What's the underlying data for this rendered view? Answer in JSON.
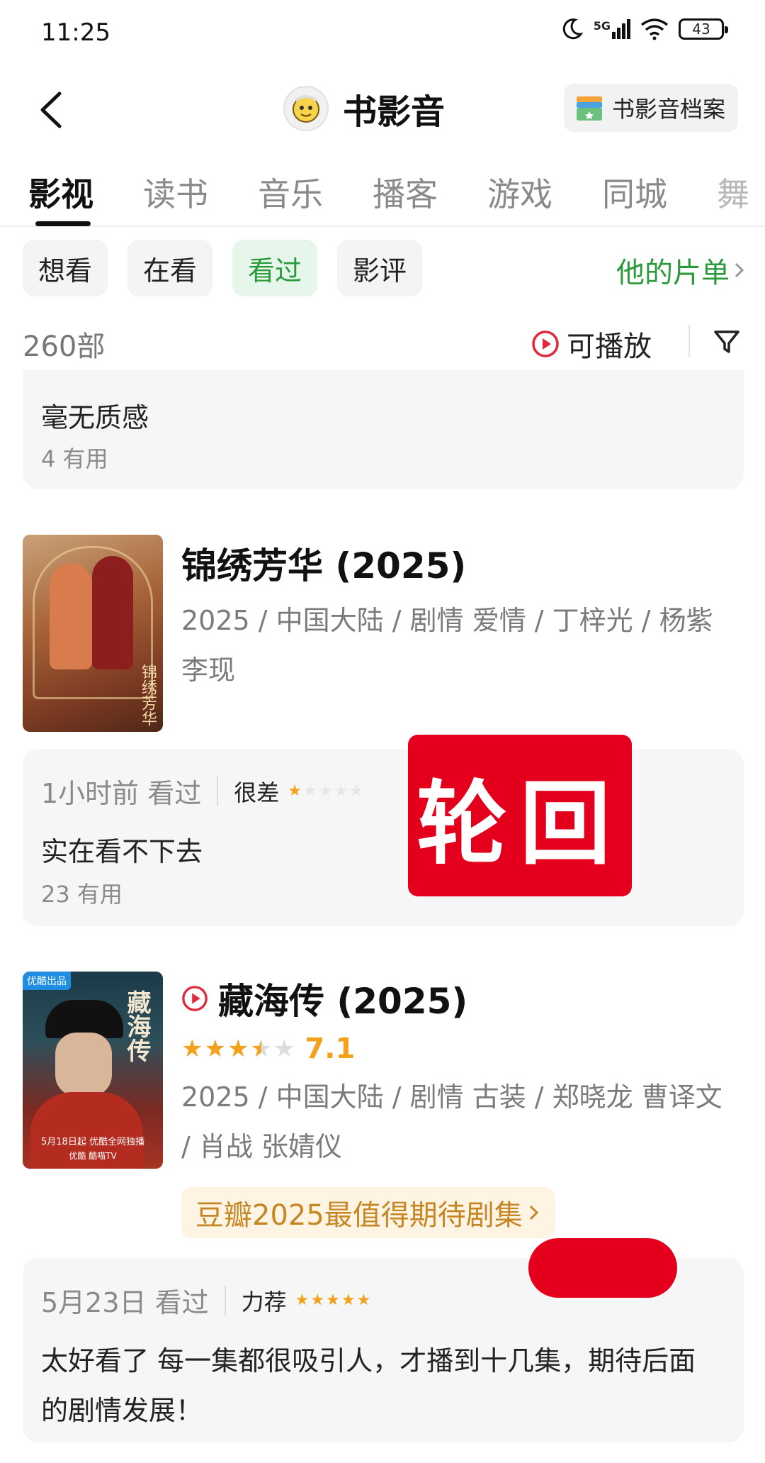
{
  "status_bar": {
    "time": "11:25",
    "network": "5G",
    "battery": "43"
  },
  "header": {
    "title": "书影音",
    "archive_label": "书影音档案"
  },
  "tabs": [
    {
      "label": "影视",
      "active": true
    },
    {
      "label": "读书",
      "active": false
    },
    {
      "label": "音乐",
      "active": false
    },
    {
      "label": "播客",
      "active": false
    },
    {
      "label": "游戏",
      "active": false
    },
    {
      "label": "同城",
      "active": false
    },
    {
      "label": "舞",
      "active": false
    }
  ],
  "filters": {
    "chips": [
      {
        "label": "想看",
        "active": false
      },
      {
        "label": "在看",
        "active": false
      },
      {
        "label": "看过",
        "active": true
      },
      {
        "label": "影评",
        "active": false
      }
    ],
    "his_list": "他的片单"
  },
  "count": {
    "text": "260部",
    "playable": "可播放"
  },
  "prev_review": {
    "text": "毫无质感",
    "helpful": "4 有用"
  },
  "items": [
    {
      "title": "锦绣芳华 (2025)",
      "info": "2025 / 中国大陆 / 剧情 爱情 / 丁梓光 / 杨紫 李现",
      "poster_text": "锦绣芳华",
      "review": {
        "time": "1小时前 看过",
        "rating_word": "很差",
        "stars": 1,
        "text": "实在看不下去",
        "helpful": "23 有用"
      }
    },
    {
      "title": "藏海传 (2025)",
      "playable": true,
      "rating_stars": 3.5,
      "score": "7.1",
      "info": "2025 / 中国大陆 / 剧情 古装 / 郑晓龙 曹译文 / 肖战 张婧仪",
      "poster_badge": "优酷出品",
      "poster_title": "藏海传",
      "poster_date": "5月18日起 优酷全网独播",
      "poster_platforms": "优酷 酷喵TV",
      "banner": "豆瓣2025最值得期待剧集",
      "review": {
        "time": "5月23日 看过",
        "rating_word": "力荐",
        "stars": 5,
        "text": "太好看了 每一集都很吸引人，才播到十几集，期待后面的剧情发展！"
      }
    }
  ],
  "overlay_text": "轮回",
  "colors": {
    "accent_green": "#2a9a3c",
    "star_orange": "#f3a01b",
    "red_mark": "#e4001c"
  }
}
